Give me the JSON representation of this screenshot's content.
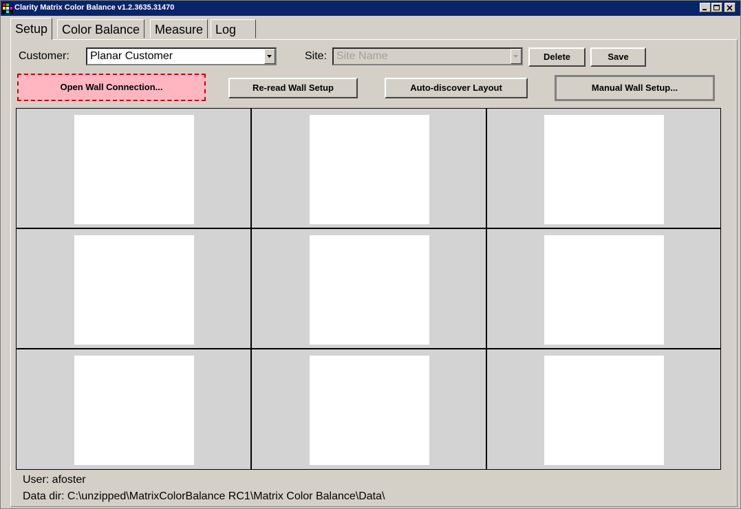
{
  "window": {
    "title": "Clarity Matrix Color Balance v1.2.3635.31470",
    "accent": "#0a246a"
  },
  "tabs": [
    {
      "label": "Setup",
      "active": true
    },
    {
      "label": "Color Balance",
      "active": false
    },
    {
      "label": "Measure",
      "active": false
    },
    {
      "label": "Log",
      "active": false
    }
  ],
  "setup": {
    "customer_label": "Customer:",
    "customer_value": "Planar Customer",
    "site_label": "Site:",
    "site_placeholder": "Site Name",
    "delete_label": "Delete",
    "save_label": "Save",
    "open_wall_label": "Open Wall Connection...",
    "reread_label": "Re-read Wall Setup",
    "autodiscover_label": "Auto-discover Layout",
    "manual_label": "Manual Wall Setup..."
  },
  "wall": {
    "rows": 3,
    "cols": 3,
    "cell_color": "#d3d3d3",
    "panel_color": "#ffffff"
  },
  "status": {
    "user": "User: afoster",
    "data_dir": "Data dir: C:\\unzipped\\MatrixColorBalance RC1\\Matrix Color Balance\\Data\\"
  }
}
